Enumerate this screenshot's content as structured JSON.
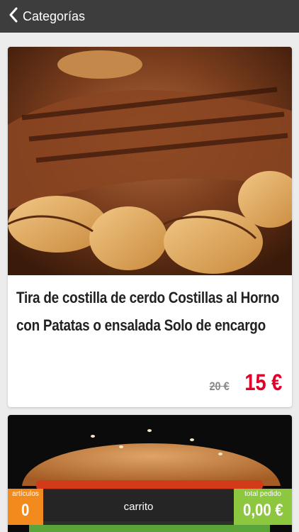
{
  "header": {
    "back_label": "Categorías",
    "back_icon": "chevron-left-icon"
  },
  "products": [
    {
      "title": " Tira  de costilla de cerdo  Costillas al Horno con Patatas o ensalada  Solo de encargo",
      "old_price": "20 €",
      "price": "15 €",
      "image": "grilled-pork-ribs-with-potatoes-photo"
    },
    {
      "image": "hamburger-photo"
    }
  ],
  "cart": {
    "count_label": "artículos",
    "count": "0",
    "label": "carrito",
    "total_label": "total pedido",
    "total": "0,00 €"
  },
  "colors": {
    "header_bg": "#3d3d3d",
    "price_red": "#e0002a",
    "count_orange": "#f28a1e",
    "total_green": "#8dc63f"
  }
}
